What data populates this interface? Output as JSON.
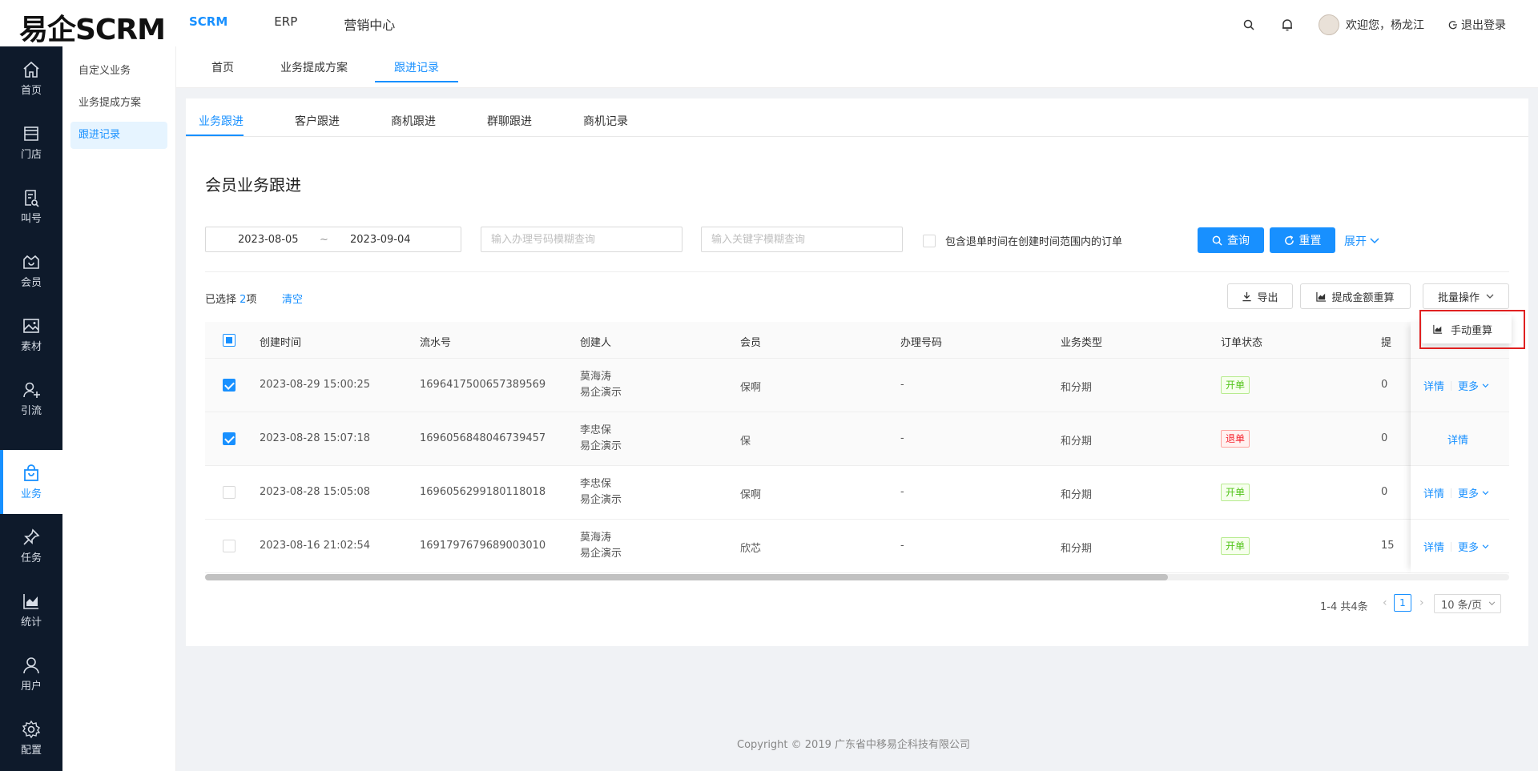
{
  "app": {
    "logo": "易企SCRM",
    "topnav": [
      "SCRM",
      "ERP",
      "营销中心"
    ],
    "welcome": "欢迎您，杨龙江",
    "logout": "退出登录"
  },
  "sidebar": {
    "items": [
      {
        "label": "首页",
        "icon": "home-icon"
      },
      {
        "label": "门店",
        "icon": "store-icon"
      },
      {
        "label": "叫号",
        "icon": "queue-icon"
      },
      {
        "label": "会员",
        "icon": "member-icon"
      },
      {
        "label": "素材",
        "icon": "image-icon"
      },
      {
        "label": "引流",
        "icon": "traffic-icon"
      },
      {
        "label": "业务",
        "icon": "bag-icon"
      },
      {
        "label": "任务",
        "icon": "pin-icon"
      },
      {
        "label": "统计",
        "icon": "chart-icon"
      },
      {
        "label": "用户",
        "icon": "user-icon"
      },
      {
        "label": "配置",
        "icon": "settings-icon"
      }
    ]
  },
  "subnav": [
    "自定义业务",
    "业务提成方案",
    "跟进记录"
  ],
  "pagetabs": [
    "首页",
    "业务提成方案",
    "跟进记录"
  ],
  "subtabs": [
    "业务跟进",
    "客户跟进",
    "商机跟进",
    "群聊跟进",
    "商机记录"
  ],
  "section_title": "会员业务跟进",
  "filters": {
    "date_start": "2023-08-05",
    "date_sep": "~",
    "date_end": "2023-09-04",
    "phone_placeholder": "输入办理号码模糊查询",
    "keyword_placeholder": "输入关键字模糊查询",
    "include_refund_label": "包含退单时间在创建时间范围内的订单",
    "query_label": "查询",
    "reset_label": "重置",
    "expand_label": "展开"
  },
  "selection": {
    "prefix": "已选择",
    "count": "2",
    "suffix": "项",
    "clear": "清空"
  },
  "toolbar": {
    "export": "导出",
    "recalc": "提成金额重算",
    "batch": "批量操作"
  },
  "dropdown": {
    "manual_recalc": "手动重算"
  },
  "table": {
    "columns": [
      "创建时间",
      "流水号",
      "创建人",
      "会员",
      "办理号码",
      "业务类型",
      "订单状态",
      "提"
    ],
    "rows": [
      {
        "checked": true,
        "time": "2023-08-29 15:00:25",
        "serial": "1696417500657389569",
        "creator": "莫海涛",
        "org": "易企演示",
        "member": "保啊",
        "phone": "-",
        "type": "和分期",
        "status": "开单",
        "status_color": "green",
        "commission": "0",
        "detail": "详情",
        "more": "更多"
      },
      {
        "checked": true,
        "time": "2023-08-28 15:07:18",
        "serial": "1696056848046739457",
        "creator": "李忠保",
        "org": "易企演示",
        "member": "保",
        "phone": "-",
        "type": "和分期",
        "status": "退单",
        "status_color": "red",
        "commission": "0",
        "detail": "详情",
        "more": ""
      },
      {
        "checked": false,
        "time": "2023-08-28 15:05:08",
        "serial": "1696056299180118018",
        "creator": "李忠保",
        "org": "易企演示",
        "member": "保啊",
        "phone": "-",
        "type": "和分期",
        "status": "开单",
        "status_color": "green",
        "commission": "0",
        "detail": "详情",
        "more": "更多"
      },
      {
        "checked": false,
        "time": "2023-08-16 21:02:54",
        "serial": "1691797679689003010",
        "creator": "莫海涛",
        "org": "易企演示",
        "member": "欣芯",
        "phone": "-",
        "type": "和分期",
        "status": "开单",
        "status_color": "green",
        "commission": "15",
        "detail": "详情",
        "more": "更多"
      }
    ]
  },
  "pagination": {
    "total": "1-4 共4条",
    "current": "1",
    "page_size": "10 条/页"
  },
  "footer": "Copyright © 2019 广东省中移易企科技有限公司",
  "colors": {
    "primary": "#1890ff",
    "sidebar_bg": "#0e1a2b",
    "tag_green": "#52c41a",
    "tag_red": "#f5222d",
    "highlight": "#e02020"
  }
}
